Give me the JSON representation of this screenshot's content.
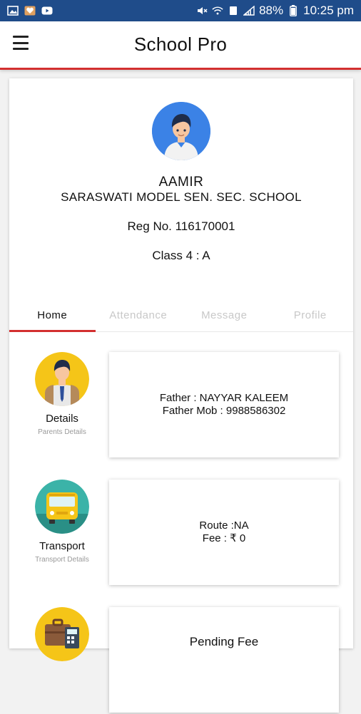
{
  "status_bar": {
    "battery": "88%",
    "time": "10:25 pm"
  },
  "app_bar": {
    "title": "School Pro"
  },
  "student": {
    "name": "AAMIR",
    "school": "SARASWATI MODEL SEN. SEC. SCHOOL",
    "reg_no": "Reg No. 116170001",
    "class_info": "Class 4 : A"
  },
  "tabs": [
    {
      "label": "Home",
      "active": true
    },
    {
      "label": "Attendance",
      "active": false
    },
    {
      "label": "Message",
      "active": false
    },
    {
      "label": "Profile",
      "active": false
    }
  ],
  "rows": [
    {
      "label": "Details",
      "sub": "Parents Details",
      "icon": "student-icon",
      "lines": [
        "Father : NAYYAR KALEEM",
        "Father Mob : 9988586302"
      ]
    },
    {
      "label": "Transport",
      "sub": "Transport Details",
      "icon": "bus-icon",
      "lines": [
        "Route :NA",
        "Fee : ₹ 0"
      ]
    },
    {
      "label": "",
      "sub": "",
      "icon": "fee-icon",
      "lines": [
        "Pending Fee"
      ]
    }
  ],
  "colors": {
    "status_bar": "#1f4c8a",
    "accent": "#d32f2f",
    "avatar_bg": "#3b82e6",
    "details_icon_bg": "#f5c518",
    "transport_icon_bg": "#3bb3a8",
    "fee_icon_bg": "#f5c518"
  }
}
